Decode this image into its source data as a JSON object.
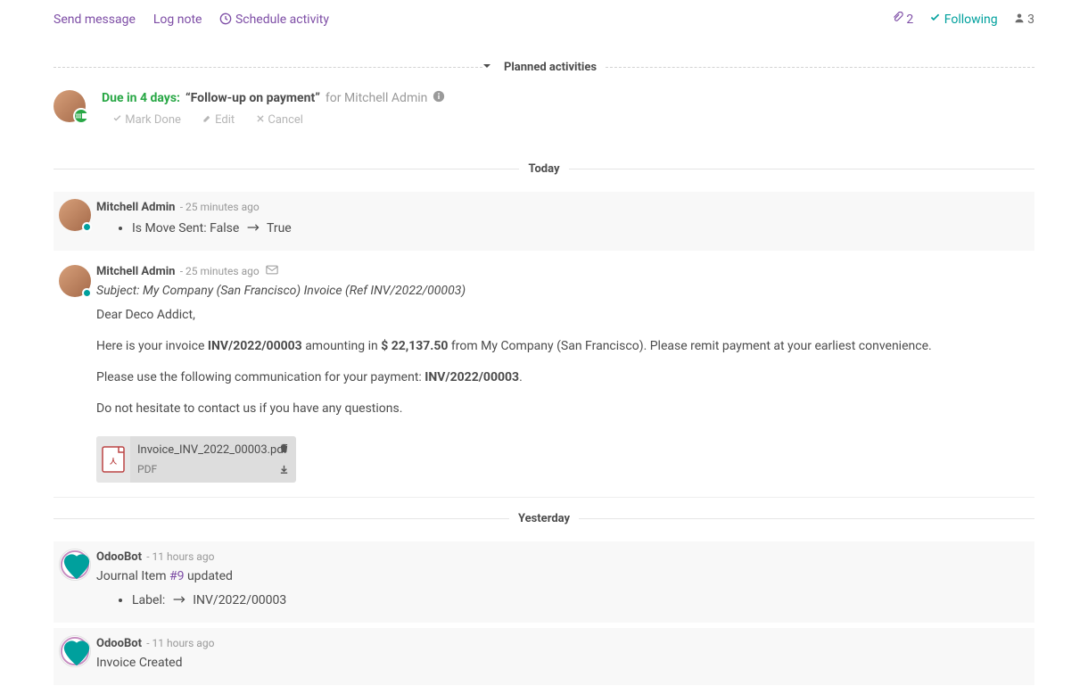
{
  "topbar": {
    "send_message": "Send message",
    "log_note": "Log note",
    "schedule_activity": "Schedule activity",
    "attachments_count": "2",
    "following": "Following",
    "followers_count": "3"
  },
  "section_planned": "Planned activities",
  "activity": {
    "due": "Due in 4 days:",
    "title": "“Follow-up on payment”",
    "for_prefix": "for ",
    "for_user": "Mitchell Admin",
    "mark_done": "Mark Done",
    "edit": "Edit",
    "cancel": "Cancel"
  },
  "section_today": "Today",
  "msg1": {
    "author": "Mitchell Admin",
    "time": "- 25 minutes ago",
    "change_label": "Is Move Sent: ",
    "change_from": "False",
    "change_to": "True"
  },
  "msg2": {
    "author": "Mitchell Admin",
    "time": "- 25 minutes ago",
    "subject": "Subject: My Company (San Francisco) Invoice (Ref INV/2022/00003)",
    "greeting": "Dear Deco Addict,",
    "p1_a": "Here is your invoice ",
    "p1_inv": "INV/2022/00003",
    "p1_b": " amounting in ",
    "p1_amt": "$ 22,137.50",
    "p1_c": " from My Company (San Francisco). Please remit payment at your earliest convenience.",
    "p2_a": "Please use the following communication for your payment: ",
    "p2_ref": "INV/2022/00003",
    "p2_b": ".",
    "p3": "Do not hesitate to contact us if you have any questions.",
    "attachment_name": "Invoice_INV_2022_00003.pdf",
    "attachment_type": "PDF"
  },
  "section_yesterday": "Yesterday",
  "msg3": {
    "author": "OdooBot",
    "time": "- 11 hours ago",
    "body_a": "Journal Item ",
    "body_ref": "#9",
    "body_b": " updated",
    "change_label": "Label: ",
    "change_to": "INV/2022/00003"
  },
  "msg4": {
    "author": "OdooBot",
    "time": "- 11 hours ago",
    "body": "Invoice Created"
  }
}
